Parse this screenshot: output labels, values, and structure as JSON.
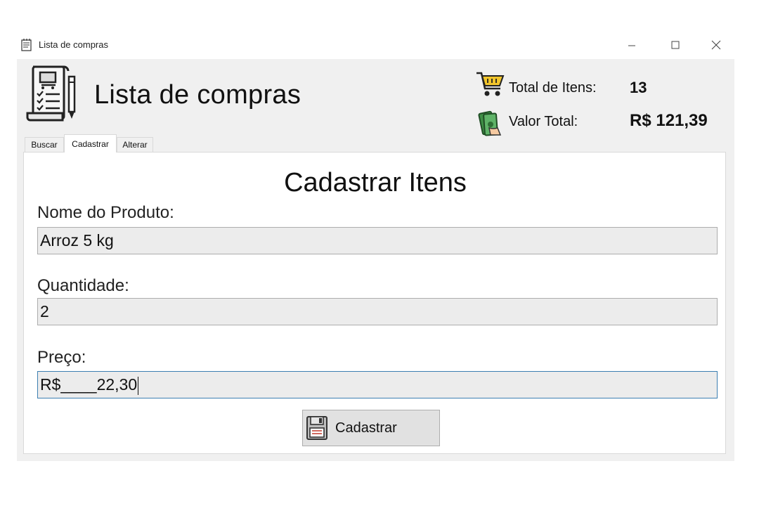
{
  "window": {
    "title": "Lista de compras"
  },
  "header": {
    "app_title": "Lista de compras",
    "total_itens_label": "Total de Itens:",
    "total_itens_value": "13",
    "valor_total_label": "Valor Total:",
    "valor_total_value": "R$ 121,39"
  },
  "tabs": [
    {
      "label": "Buscar",
      "selected": false
    },
    {
      "label": "Cadastrar",
      "selected": true
    },
    {
      "label": "Alterar",
      "selected": false
    }
  ],
  "form": {
    "title": "Cadastrar Itens",
    "nome_label": "Nome do Produto:",
    "nome_value": "Arroz 5 kg",
    "quantidade_label": "Quantidade:",
    "quantidade_value": "2",
    "preco_label": "Preço:",
    "preco_value": "R$____22,30",
    "submit_label": "Cadastrar"
  },
  "icons": {
    "window": "notepad-icon",
    "logo": "shopping-list-icon",
    "total_itens": "shopping-cart-icon",
    "valor_total": "money-icon",
    "submit": "floppy-disk-icon"
  },
  "colors": {
    "window_bg": "#f0f0f0",
    "panel_bg": "#ffffff",
    "field_bg": "#ececec",
    "focus_border": "#3c7fb1",
    "cart_yellow": "#f2c52b",
    "money_green": "#3f8f46"
  }
}
